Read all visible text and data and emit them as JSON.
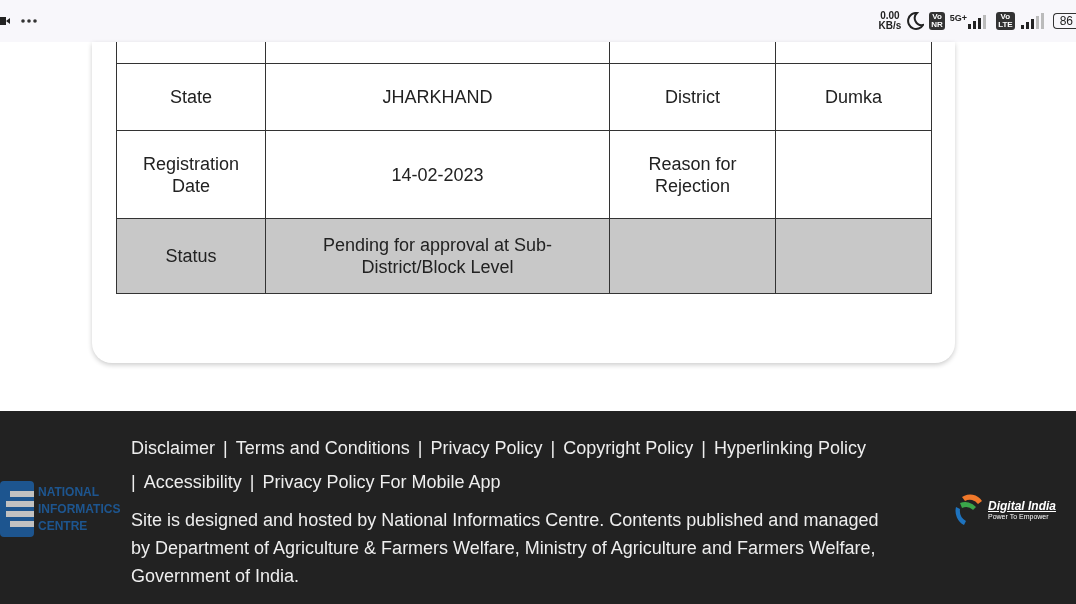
{
  "status_bar": {
    "speed_value": "0.00",
    "speed_unit": "KB/s",
    "sim1_badge": [
      "Vo",
      "NR"
    ],
    "sim1_network": "5G+",
    "sim2_badge": [
      "Vo",
      "LTE"
    ],
    "battery": "86"
  },
  "table": {
    "rows": [
      {
        "cells": [
          "State",
          "JHARKHAND",
          "District",
          "Dumka"
        ],
        "highlighted": false
      },
      {
        "cells": [
          "Registration Date",
          "14-02-2023",
          "Reason for Rejection",
          ""
        ],
        "highlighted": false
      },
      {
        "cells": [
          "Status",
          "Pending for approval at Sub-District/Block Level",
          "",
          ""
        ],
        "highlighted": true
      }
    ]
  },
  "footer": {
    "links": [
      {
        "label": "Disclaimer"
      },
      {
        "separator": "|",
        "label": "Terms and Conditions"
      },
      {
        "separator": "|",
        "label": "Privacy Policy"
      },
      {
        "separator": "|",
        "label": "Copyright Policy"
      },
      {
        "separator": "|",
        "label": "Hyperlinking Policy"
      },
      {
        "separator": "|",
        "label": "Accessibility"
      },
      {
        "separator": "|",
        "label": "Privacy Policy For Mobile App"
      }
    ],
    "nic_logo": [
      "NATIONAL",
      "INFORMATICS",
      "CENTRE"
    ],
    "notice": "Site is designed and hosted by National Informatics Centre. Contents published and managed by Department of Agriculture & Farmers Welfare, Ministry of Agriculture and Farmers Welfare, Government of India.",
    "digital_india_logo": {
      "title": "Digital India",
      "tagline": "Power To Empower"
    }
  }
}
